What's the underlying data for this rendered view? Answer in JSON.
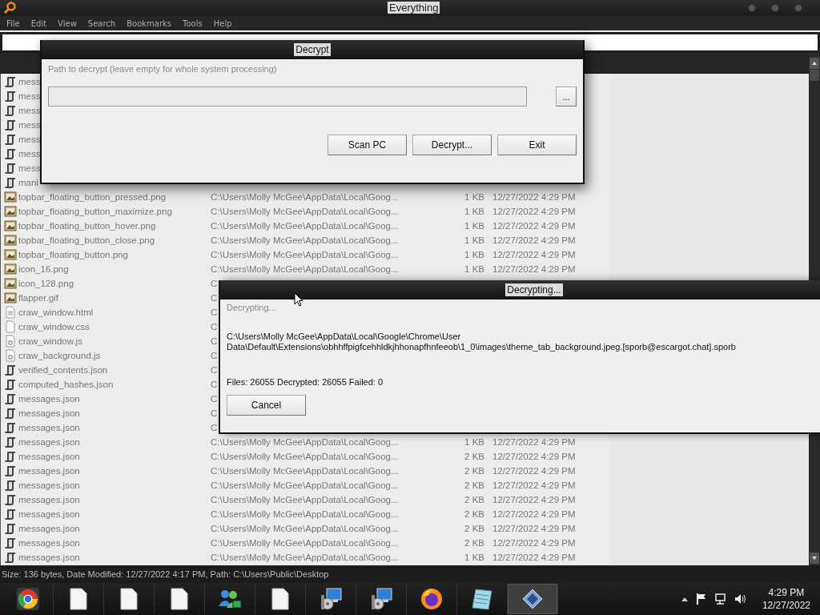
{
  "window": {
    "title": "Everything"
  },
  "menu": [
    "File",
    "Edit",
    "View",
    "Search",
    "Bookmarks",
    "Tools",
    "Help"
  ],
  "rows": [
    {
      "kind": "json",
      "name": "mess"
    },
    {
      "kind": "json",
      "name": "mess"
    },
    {
      "kind": "json",
      "name": "mess"
    },
    {
      "kind": "json",
      "name": "mess"
    },
    {
      "kind": "json",
      "name": "mess"
    },
    {
      "kind": "json",
      "name": "mess"
    },
    {
      "kind": "json",
      "name": "mess"
    },
    {
      "kind": "json",
      "name": "mani"
    },
    {
      "kind": "image",
      "name": "topbar_floating_button_pressed.png",
      "path": "C:\\Users\\Molly McGee\\AppData\\Local\\Goog...",
      "size": "1 KB",
      "date": "12/27/2022 4:29 PM"
    },
    {
      "kind": "image",
      "name": "topbar_floating_button_maximize.png",
      "path": "C:\\Users\\Molly McGee\\AppData\\Local\\Goog...",
      "size": "1 KB",
      "date": "12/27/2022 4:29 PM"
    },
    {
      "kind": "image",
      "name": "topbar_floating_button_hover.png",
      "path": "C:\\Users\\Molly McGee\\AppData\\Local\\Goog...",
      "size": "1 KB",
      "date": "12/27/2022 4:29 PM"
    },
    {
      "kind": "image",
      "name": "topbar_floating_button_close.png",
      "path": "C:\\Users\\Molly McGee\\AppData\\Local\\Goog...",
      "size": "1 KB",
      "date": "12/27/2022 4:29 PM"
    },
    {
      "kind": "image",
      "name": "topbar_floating_button.png",
      "path": "C:\\Users\\Molly McGee\\AppData\\Local\\Goog...",
      "size": "1 KB",
      "date": "12/27/2022 4:29 PM"
    },
    {
      "kind": "image",
      "name": "icon_16.png",
      "path": "C:\\Users\\Molly McGee\\AppData\\Local\\Goog...",
      "size": "1 KB",
      "date": "12/27/2022 4:29 PM"
    },
    {
      "kind": "image",
      "name": "icon_128.png",
      "path": "C"
    },
    {
      "kind": "image",
      "name": "flapper.gif",
      "path": "C"
    },
    {
      "kind": "html",
      "name": "craw_window.html",
      "path": "C"
    },
    {
      "kind": "text",
      "name": "craw_window.css",
      "path": "C"
    },
    {
      "kind": "script",
      "name": "craw_window.js",
      "path": "C"
    },
    {
      "kind": "script",
      "name": "craw_background.js",
      "path": "C"
    },
    {
      "kind": "json",
      "name": "verified_contents.json",
      "path": "C"
    },
    {
      "kind": "json",
      "name": "computed_hashes.json",
      "path": "C"
    },
    {
      "kind": "json",
      "name": "messages.json",
      "path": "C"
    },
    {
      "kind": "json",
      "name": "messages.json",
      "path": "C"
    },
    {
      "kind": "json",
      "name": "messages.json",
      "path": "C"
    },
    {
      "kind": "json",
      "name": "messages.json",
      "path": "C:\\Users\\Molly McGee\\AppData\\Local\\Goog...",
      "size": "1 KB",
      "date": "12/27/2022 4:29 PM"
    },
    {
      "kind": "json",
      "name": "messages.json",
      "path": "C:\\Users\\Molly McGee\\AppData\\Local\\Goog...",
      "size": "2 KB",
      "date": "12/27/2022 4:29 PM"
    },
    {
      "kind": "json",
      "name": "messages.json",
      "path": "C:\\Users\\Molly McGee\\AppData\\Local\\Goog...",
      "size": "2 KB",
      "date": "12/27/2022 4:29 PM"
    },
    {
      "kind": "json",
      "name": "messages.json",
      "path": "C:\\Users\\Molly McGee\\AppData\\Local\\Goog...",
      "size": "2 KB",
      "date": "12/27/2022 4:29 PM"
    },
    {
      "kind": "json",
      "name": "messages.json",
      "path": "C:\\Users\\Molly McGee\\AppData\\Local\\Goog...",
      "size": "2 KB",
      "date": "12/27/2022 4:29 PM"
    },
    {
      "kind": "json",
      "name": "messages.json",
      "path": "C:\\Users\\Molly McGee\\AppData\\Local\\Goog...",
      "size": "2 KB",
      "date": "12/27/2022 4:29 PM"
    },
    {
      "kind": "json",
      "name": "messages.json",
      "path": "C:\\Users\\Molly McGee\\AppData\\Local\\Goog...",
      "size": "2 KB",
      "date": "12/27/2022 4:29 PM"
    },
    {
      "kind": "json",
      "name": "messages.json",
      "path": "C:\\Users\\Molly McGee\\AppData\\Local\\Goog...",
      "size": "2 KB",
      "date": "12/27/2022 4:29 PM"
    },
    {
      "kind": "json",
      "name": "messages.json",
      "path": "C:\\Users\\Molly McGee\\AppData\\Local\\Goog...",
      "size": "1 KB",
      "date": "12/27/2022 4:29 PM"
    }
  ],
  "status_bar": "Size: 136 bytes, Date Modified: 12/27/2022 4:17 PM, Path: C:\\Users\\Public\\Desktop",
  "decrypt_dialog": {
    "title": "Decrypt",
    "label": "Path to decrypt (leave empty for whole system processing)",
    "browse": "...",
    "buttons": [
      "Scan PC",
      "Decrypt...",
      "Exit"
    ]
  },
  "progress_dialog": {
    "title": "Decrypting...",
    "status": "Decrypting...",
    "current_file": "C:\\Users\\Molly McGee\\AppData\\Local\\Google\\Chrome\\User Data\\Default\\Extensions\\obhhffpigfcehhldkjhhonapfhnfeeob\\1_0\\images\\theme_tab_background.jpeg.[sporb@escargot.chat].sporb",
    "counts": "Files: 26055 Decrypted: 26055 Failed: 0",
    "cancel": "Cancel"
  },
  "taskbar": {
    "items": [
      {
        "kind": "browser",
        "selected": false
      },
      {
        "kind": "document",
        "selected": false
      },
      {
        "kind": "document",
        "selected": false
      },
      {
        "kind": "document",
        "selected": false
      },
      {
        "kind": "people",
        "selected": false
      },
      {
        "kind": "document",
        "selected": false
      },
      {
        "kind": "installer",
        "selected": false
      },
      {
        "kind": "installer",
        "selected": false
      },
      {
        "kind": "fox",
        "selected": false
      },
      {
        "kind": "notepad",
        "selected": false
      },
      {
        "kind": "diamond",
        "selected": true
      }
    ],
    "time": "4:29 PM",
    "date": "12/27/2022"
  }
}
